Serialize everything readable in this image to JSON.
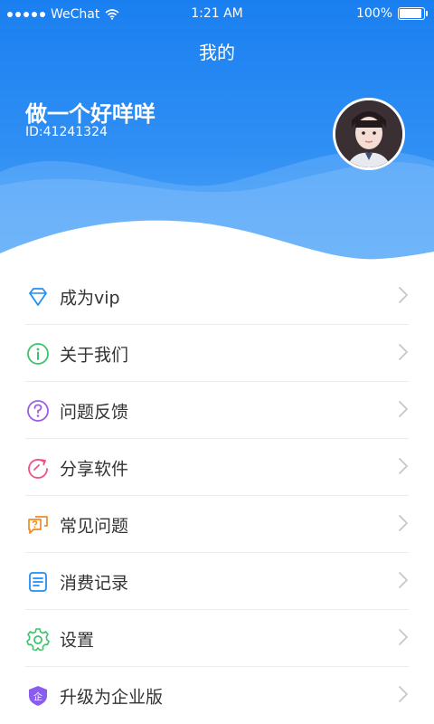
{
  "status_bar": {
    "carrier": "WeChat",
    "time": "1:21 AM",
    "battery": "100%"
  },
  "header": {
    "title": "我的",
    "user_name": "做一个好咩咩",
    "user_id": "ID:41241324"
  },
  "colors": {
    "primary": "#1a7ff0",
    "text": "#333333",
    "chevron": "#c7c7c7"
  },
  "menu": [
    {
      "label": "成为vip",
      "icon": "diamond-icon",
      "color": "#1f8ef5"
    },
    {
      "label": "关于我们",
      "icon": "info-icon",
      "color": "#3cc46a"
    },
    {
      "label": "问题反馈",
      "icon": "question-icon",
      "color": "#9b5de5"
    },
    {
      "label": "分享软件",
      "icon": "share-icon",
      "color": "#f0508a"
    },
    {
      "label": "常见问题",
      "icon": "faq-icon",
      "color": "#f08a24"
    },
    {
      "label": "消费记录",
      "icon": "record-icon",
      "color": "#1f8ef5"
    },
    {
      "label": "设置",
      "icon": "gear-icon",
      "color": "#3cc46a"
    },
    {
      "label": "升级为企业版",
      "icon": "enterprise-icon",
      "color": "#8a5cf0"
    }
  ]
}
